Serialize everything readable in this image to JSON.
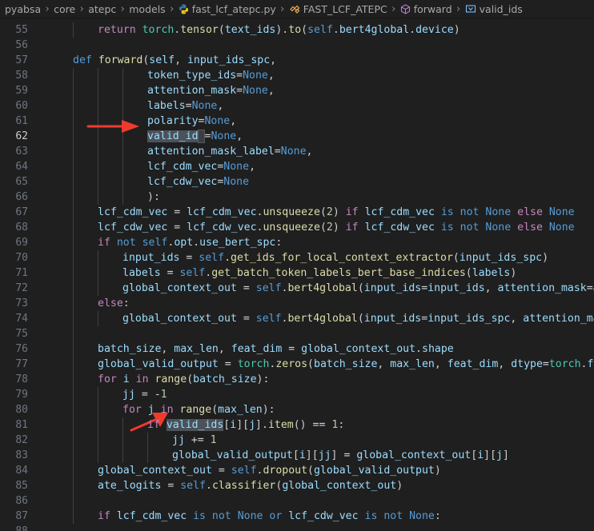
{
  "breadcrumb": {
    "items": [
      {
        "label": "pyabsa",
        "icon": ""
      },
      {
        "label": "core",
        "icon": ""
      },
      {
        "label": "atepc",
        "icon": ""
      },
      {
        "label": "models",
        "icon": ""
      },
      {
        "label": "fast_lcf_atepc.py",
        "icon": "python-file-icon"
      },
      {
        "label": "FAST_LCF_ATEPC",
        "icon": "class-symbol-icon"
      },
      {
        "label": "forward",
        "icon": "method-symbol-icon"
      },
      {
        "label": "valid_ids",
        "icon": "variable-symbol-icon"
      }
    ],
    "separator": "›"
  },
  "editor": {
    "active_line": 62,
    "colors": {
      "background": "#1f1f1f",
      "keyword": "#569cd6",
      "control": "#c586c0",
      "function": "#dcdcaa",
      "variable": "#9cdcfe",
      "class": "#4ec9b0",
      "annotation_arrow": "#f03a2e"
    },
    "lines": [
      {
        "n": "55",
        "indent": 2,
        "tokens": [
          [
            "ctl",
            "return "
          ],
          [
            "cls",
            "torch"
          ],
          [
            "pl",
            "."
          ],
          [
            "fn",
            "tensor"
          ],
          [
            "pl",
            "("
          ],
          [
            "var",
            "text_ids"
          ],
          [
            "pl",
            ")."
          ],
          [
            "fn",
            "to"
          ],
          [
            "pl",
            "("
          ],
          [
            "kw",
            "self"
          ],
          [
            "pl",
            "."
          ],
          [
            "var",
            "bert4global"
          ],
          [
            "pl",
            "."
          ],
          [
            "var",
            "device"
          ],
          [
            "pl",
            ")"
          ]
        ]
      },
      {
        "n": "56",
        "indent": 0,
        "tokens": []
      },
      {
        "n": "57",
        "indent": 1,
        "tokens": [
          [
            "kw",
            "def "
          ],
          [
            "fn",
            "forward"
          ],
          [
            "pl",
            "("
          ],
          [
            "par",
            "self"
          ],
          [
            "pl",
            ", "
          ],
          [
            "par",
            "input_ids_spc"
          ],
          [
            "pl",
            ","
          ]
        ]
      },
      {
        "n": "58",
        "indent": 4,
        "tokens": [
          [
            "par",
            "token_type_ids"
          ],
          [
            "op",
            "="
          ],
          [
            "kw",
            "None"
          ],
          [
            "pl",
            ","
          ]
        ]
      },
      {
        "n": "59",
        "indent": 4,
        "tokens": [
          [
            "par",
            "attention_mask"
          ],
          [
            "op",
            "="
          ],
          [
            "kw",
            "None"
          ],
          [
            "pl",
            ","
          ]
        ]
      },
      {
        "n": "60",
        "indent": 4,
        "tokens": [
          [
            "par",
            "labels"
          ],
          [
            "op",
            "="
          ],
          [
            "kw",
            "None"
          ],
          [
            "pl",
            ","
          ]
        ]
      },
      {
        "n": "61",
        "indent": 4,
        "tokens": [
          [
            "par",
            "polarity"
          ],
          [
            "op",
            "="
          ],
          [
            "kw",
            "None"
          ],
          [
            "pl",
            ","
          ]
        ]
      },
      {
        "n": "62",
        "indent": 4,
        "tokens": [
          [
            "par hl",
            "valid_id"
          ],
          [
            "pl hl-sel",
            " "
          ],
          [
            "op",
            "="
          ],
          [
            "kw",
            "None"
          ],
          [
            "pl",
            ","
          ]
        ]
      },
      {
        "n": "63",
        "indent": 4,
        "tokens": [
          [
            "par",
            "attention_mask_label"
          ],
          [
            "op",
            "="
          ],
          [
            "kw",
            "None"
          ],
          [
            "pl",
            ","
          ]
        ]
      },
      {
        "n": "64",
        "indent": 4,
        "tokens": [
          [
            "par",
            "lcf_cdm_vec"
          ],
          [
            "op",
            "="
          ],
          [
            "kw",
            "None"
          ],
          [
            "pl",
            ","
          ]
        ]
      },
      {
        "n": "65",
        "indent": 4,
        "tokens": [
          [
            "par",
            "lcf_cdw_vec"
          ],
          [
            "op",
            "="
          ],
          [
            "kw",
            "None"
          ]
        ]
      },
      {
        "n": "66",
        "indent": 4,
        "tokens": [
          [
            "pl",
            "):"
          ]
        ]
      },
      {
        "n": "67",
        "indent": 2,
        "tokens": [
          [
            "var",
            "lcf_cdm_vec"
          ],
          [
            "op",
            " = "
          ],
          [
            "var",
            "lcf_cdm_vec"
          ],
          [
            "pl",
            "."
          ],
          [
            "fn",
            "unsqueeze"
          ],
          [
            "pl",
            "("
          ],
          [
            "num",
            "2"
          ],
          [
            "pl",
            ") "
          ],
          [
            "ctl",
            "if "
          ],
          [
            "var",
            "lcf_cdm_vec"
          ],
          [
            "kw",
            " is not None "
          ],
          [
            "ctl",
            "else "
          ],
          [
            "kw",
            "None"
          ]
        ]
      },
      {
        "n": "68",
        "indent": 2,
        "tokens": [
          [
            "var",
            "lcf_cdw_vec"
          ],
          [
            "op",
            " = "
          ],
          [
            "var",
            "lcf_cdw_vec"
          ],
          [
            "pl",
            "."
          ],
          [
            "fn",
            "unsqueeze"
          ],
          [
            "pl",
            "("
          ],
          [
            "num",
            "2"
          ],
          [
            "pl",
            ") "
          ],
          [
            "ctl",
            "if "
          ],
          [
            "var",
            "lcf_cdw_vec"
          ],
          [
            "kw",
            " is not None "
          ],
          [
            "ctl",
            "else "
          ],
          [
            "kw",
            "None"
          ]
        ]
      },
      {
        "n": "69",
        "indent": 2,
        "tokens": [
          [
            "ctl",
            "if "
          ],
          [
            "kw",
            "not "
          ],
          [
            "kw",
            "self"
          ],
          [
            "pl",
            "."
          ],
          [
            "var",
            "opt"
          ],
          [
            "pl",
            "."
          ],
          [
            "var",
            "use_bert_spc"
          ],
          [
            "pl",
            ":"
          ]
        ]
      },
      {
        "n": "70",
        "indent": 3,
        "tokens": [
          [
            "var",
            "input_ids"
          ],
          [
            "op",
            " = "
          ],
          [
            "kw",
            "self"
          ],
          [
            "pl",
            "."
          ],
          [
            "fn",
            "get_ids_for_local_context_extractor"
          ],
          [
            "pl",
            "("
          ],
          [
            "var",
            "input_ids_spc"
          ],
          [
            "pl",
            ")"
          ]
        ]
      },
      {
        "n": "71",
        "indent": 3,
        "tokens": [
          [
            "var",
            "labels"
          ],
          [
            "op",
            " = "
          ],
          [
            "kw",
            "self"
          ],
          [
            "pl",
            "."
          ],
          [
            "fn",
            "get_batch_token_labels_bert_base_indices"
          ],
          [
            "pl",
            "("
          ],
          [
            "var",
            "labels"
          ],
          [
            "pl",
            ")"
          ]
        ]
      },
      {
        "n": "72",
        "indent": 3,
        "tokens": [
          [
            "var",
            "global_context_out"
          ],
          [
            "op",
            " = "
          ],
          [
            "kw",
            "self"
          ],
          [
            "pl",
            "."
          ],
          [
            "fn",
            "bert4global"
          ],
          [
            "pl",
            "("
          ],
          [
            "par",
            "input_ids"
          ],
          [
            "op",
            "="
          ],
          [
            "var",
            "input_ids"
          ],
          [
            "pl",
            ", "
          ],
          [
            "par",
            "attention_mask"
          ],
          [
            "op",
            "="
          ],
          [
            "var",
            "att"
          ]
        ]
      },
      {
        "n": "73",
        "indent": 2,
        "tokens": [
          [
            "ctl",
            "else"
          ],
          [
            "pl",
            ":"
          ]
        ]
      },
      {
        "n": "74",
        "indent": 3,
        "tokens": [
          [
            "var",
            "global_context_out"
          ],
          [
            "op",
            " = "
          ],
          [
            "kw",
            "self"
          ],
          [
            "pl",
            "."
          ],
          [
            "fn",
            "bert4global"
          ],
          [
            "pl",
            "("
          ],
          [
            "par",
            "input_ids"
          ],
          [
            "op",
            "="
          ],
          [
            "var",
            "input_ids_spc"
          ],
          [
            "pl",
            ", "
          ],
          [
            "par",
            "attention_mask"
          ]
        ]
      },
      {
        "n": "75",
        "indent": 0,
        "tokens": []
      },
      {
        "n": "76",
        "indent": 2,
        "tokens": [
          [
            "var",
            "batch_size"
          ],
          [
            "pl",
            ", "
          ],
          [
            "var",
            "max_len"
          ],
          [
            "pl",
            ", "
          ],
          [
            "var",
            "feat_dim"
          ],
          [
            "op",
            " = "
          ],
          [
            "var",
            "global_context_out"
          ],
          [
            "pl",
            "."
          ],
          [
            "var",
            "shape"
          ]
        ]
      },
      {
        "n": "77",
        "indent": 2,
        "tokens": [
          [
            "var",
            "global_valid_output"
          ],
          [
            "op",
            " = "
          ],
          [
            "cls",
            "torch"
          ],
          [
            "pl",
            "."
          ],
          [
            "fn",
            "zeros"
          ],
          [
            "pl",
            "("
          ],
          [
            "var",
            "batch_size"
          ],
          [
            "pl",
            ", "
          ],
          [
            "var",
            "max_len"
          ],
          [
            "pl",
            ", "
          ],
          [
            "var",
            "feat_dim"
          ],
          [
            "pl",
            ", "
          ],
          [
            "par",
            "dtype"
          ],
          [
            "op",
            "="
          ],
          [
            "cls",
            "torch"
          ],
          [
            "pl",
            "."
          ],
          [
            "var",
            "floa"
          ]
        ]
      },
      {
        "n": "78",
        "indent": 2,
        "tokens": [
          [
            "ctl",
            "for "
          ],
          [
            "var",
            "i"
          ],
          [
            "ctl",
            " in "
          ],
          [
            "fn",
            "range"
          ],
          [
            "pl",
            "("
          ],
          [
            "var",
            "batch_size"
          ],
          [
            "pl",
            "):"
          ]
        ]
      },
      {
        "n": "79",
        "indent": 3,
        "tokens": [
          [
            "var",
            "jj"
          ],
          [
            "op",
            " = "
          ],
          [
            "op",
            "-"
          ],
          [
            "num",
            "1"
          ]
        ]
      },
      {
        "n": "80",
        "indent": 3,
        "tokens": [
          [
            "ctl",
            "for "
          ],
          [
            "var",
            "j"
          ],
          [
            "ctl",
            " in "
          ],
          [
            "fn",
            "range"
          ],
          [
            "pl",
            "("
          ],
          [
            "var",
            "max_len"
          ],
          [
            "pl",
            "):"
          ]
        ]
      },
      {
        "n": "81",
        "indent": 4,
        "tokens": [
          [
            "ctl",
            "if "
          ],
          [
            "var hl",
            "valid_ids"
          ],
          [
            "pl",
            "["
          ],
          [
            "var",
            "i"
          ],
          [
            "pl",
            "]["
          ],
          [
            "var",
            "j"
          ],
          [
            "pl",
            "]."
          ],
          [
            "fn",
            "item"
          ],
          [
            "pl",
            "() "
          ],
          [
            "op",
            "=="
          ],
          [
            "pl",
            " "
          ],
          [
            "num",
            "1"
          ],
          [
            "pl",
            ":"
          ]
        ]
      },
      {
        "n": "82",
        "indent": 5,
        "tokens": [
          [
            "var",
            "jj"
          ],
          [
            "op",
            " += "
          ],
          [
            "num",
            "1"
          ]
        ]
      },
      {
        "n": "83",
        "indent": 5,
        "tokens": [
          [
            "var",
            "global_valid_output"
          ],
          [
            "pl",
            "["
          ],
          [
            "var",
            "i"
          ],
          [
            "pl",
            "]["
          ],
          [
            "var",
            "jj"
          ],
          [
            "pl",
            "]"
          ],
          [
            "op",
            " = "
          ],
          [
            "var",
            "global_context_out"
          ],
          [
            "pl",
            "["
          ],
          [
            "var",
            "i"
          ],
          [
            "pl",
            "]["
          ],
          [
            "var",
            "j"
          ],
          [
            "pl",
            "]"
          ]
        ]
      },
      {
        "n": "84",
        "indent": 2,
        "tokens": [
          [
            "var",
            "global_context_out"
          ],
          [
            "op",
            " = "
          ],
          [
            "kw",
            "self"
          ],
          [
            "pl",
            "."
          ],
          [
            "fn",
            "dropout"
          ],
          [
            "pl",
            "("
          ],
          [
            "var",
            "global_valid_output"
          ],
          [
            "pl",
            ")"
          ]
        ]
      },
      {
        "n": "85",
        "indent": 2,
        "tokens": [
          [
            "var",
            "ate_logits"
          ],
          [
            "op",
            " = "
          ],
          [
            "kw",
            "self"
          ],
          [
            "pl",
            "."
          ],
          [
            "fn",
            "classifier"
          ],
          [
            "pl",
            "("
          ],
          [
            "var",
            "global_context_out"
          ],
          [
            "pl",
            ")"
          ]
        ]
      },
      {
        "n": "86",
        "indent": 0,
        "tokens": []
      },
      {
        "n": "87",
        "indent": 2,
        "tokens": [
          [
            "ctl",
            "if "
          ],
          [
            "var",
            "lcf_cdm_vec"
          ],
          [
            "kw",
            " is not None "
          ],
          [
            "kw",
            "or "
          ],
          [
            "var",
            "lcf_cdw_vec"
          ],
          [
            "kw",
            " is not None"
          ],
          [
            "pl",
            ":"
          ]
        ]
      },
      {
        "n": "88",
        "indent": 0,
        "tokens": []
      }
    ]
  }
}
